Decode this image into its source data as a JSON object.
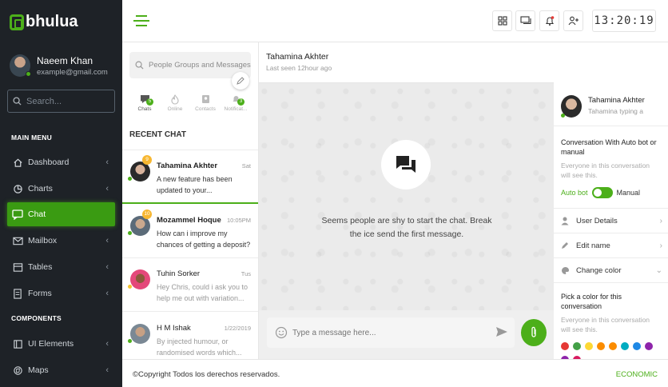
{
  "colors": {
    "accent": "#4caf1a",
    "sidebar_bg": "#1e2227",
    "badge_yellow": "#f7b731"
  },
  "brand": {
    "logo_letter": "B",
    "name": "bhulua"
  },
  "profile": {
    "name": "Naeem Khan",
    "email": "example@gmail.com"
  },
  "sidebar": {
    "search_placeholder": "Search...",
    "main_menu_label": "MAIN MENU",
    "components_label": "COMPONENTS",
    "items": [
      {
        "label": "Dashboard",
        "icon": "home-icon"
      },
      {
        "label": "Charts",
        "icon": "pie-chart-icon"
      },
      {
        "label": "Chat",
        "icon": "chat-icon",
        "active": true
      },
      {
        "label": "Mailbox",
        "icon": "mail-icon"
      },
      {
        "label": "Tables",
        "icon": "table-icon"
      },
      {
        "label": "Forms",
        "icon": "form-icon"
      },
      {
        "label": "UI Elements",
        "icon": "ui-elements-icon"
      },
      {
        "label": "Maps",
        "icon": "map-icon"
      }
    ]
  },
  "topbar": {
    "clock": "13:20:19"
  },
  "chat_list": {
    "search_placeholder": "People Groups and Messages",
    "tabs": [
      {
        "label": "Chats",
        "badge": "5"
      },
      {
        "label": "Online"
      },
      {
        "label": "Contacts"
      },
      {
        "label": "Notificat...",
        "badge": "3"
      }
    ],
    "recent_label": "RECENT CHAT",
    "items": [
      {
        "name": "Tahamina Akhter",
        "time": "Sat",
        "message": "A new feature has been updated to your...",
        "count": "9",
        "status": "online"
      },
      {
        "name": "Mozammel Hoque",
        "time": "10:05PM",
        "message": "How can i improve my chances of getting a deposit?",
        "count": "10",
        "status": "online"
      },
      {
        "name": "Tuhin Sorker",
        "time": "Tus",
        "message": "Hey Chris, could i ask you to help me out with variation...",
        "status": "away"
      },
      {
        "name": "H M Ishak",
        "time": "1/22/2019",
        "message": "By injected humour, or randomised words which...",
        "status": "online"
      }
    ]
  },
  "conversation": {
    "name": "Tahamina Akhter",
    "status": "Last seen 12hour ago",
    "empty_message": "Seems people are shy to start the chat. Break the ice send the first message.",
    "input_placeholder": "Type a message here..."
  },
  "details": {
    "name": "Tahamina Akhter",
    "typing": "Tahamina typing a",
    "bot_title": "Conversation With Auto bot or manual",
    "bot_sub": "Everyone in this conversation will see this.",
    "auto_label": "Auto bot",
    "manual_label": "Manual",
    "rows": [
      {
        "label": "User Details"
      },
      {
        "label": "Edit name"
      },
      {
        "label": "Change color"
      }
    ],
    "color_title": "Pick a color for this conversation",
    "color_sub": "Everyone in this conversation will see this.",
    "swatches": [
      "#e53935",
      "#43a047",
      "#fdd835",
      "#fb8c00",
      "#fb8c00",
      "#00acc1",
      "#1e88e5",
      "#8e24aa",
      "#8e24aa",
      "#d81b60"
    ]
  },
  "footer": {
    "copyright": "©Copyright Todos los derechos reservados.",
    "link": "ECONOMIC"
  }
}
